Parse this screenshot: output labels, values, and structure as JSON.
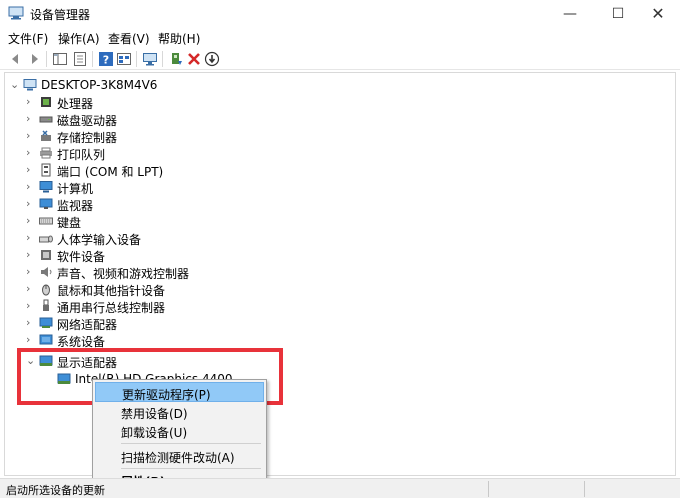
{
  "window": {
    "title": "设备管理器",
    "minimize_glyph": "—",
    "maximize_glyph": "☐",
    "close_glyph": "✕"
  },
  "menu": [
    "文件(F)",
    "操作(A)",
    "查看(V)",
    "帮助(H)"
  ],
  "toolbar": {
    "icons": [
      "back-icon",
      "forward-icon",
      "show-hide-tree-icon",
      "properties-icon",
      "help-icon",
      "view-icon",
      "monitor-scan-icon",
      "update-driver-icon",
      "uninstall-icon",
      "disable-icon"
    ],
    "uninstall_color": "#d42828"
  },
  "tree": {
    "root": "DESKTOP-3K8M4V6",
    "categories": [
      {
        "label": "处理器",
        "icon": "processor-icon"
      },
      {
        "label": "磁盘驱动器",
        "icon": "disk-drive-icon"
      },
      {
        "label": "存储控制器",
        "icon": "storage-controller-icon"
      },
      {
        "label": "打印队列",
        "icon": "printer-icon"
      },
      {
        "label": "端口 (COM 和 LPT)",
        "icon": "port-icon"
      },
      {
        "label": "计算机",
        "icon": "computer-icon"
      },
      {
        "label": "监视器",
        "icon": "monitor-icon"
      },
      {
        "label": "键盘",
        "icon": "keyboard-icon"
      },
      {
        "label": "人体学输入设备",
        "icon": "hid-icon"
      },
      {
        "label": "软件设备",
        "icon": "software-device-icon"
      },
      {
        "label": "声音、视频和游戏控制器",
        "icon": "sound-icon"
      },
      {
        "label": "鼠标和其他指针设备",
        "icon": "mouse-icon"
      },
      {
        "label": "通用串行总线控制器",
        "icon": "usb-icon"
      },
      {
        "label": "网络适配器",
        "icon": "network-adapter-icon"
      },
      {
        "label": "系统设备",
        "icon": "system-device-icon"
      },
      {
        "label": "显示适配器",
        "icon": "display-adapter-icon"
      }
    ],
    "expanded_child": "Intel(R) HD Graphics 4400"
  },
  "context_menu": {
    "items": [
      {
        "label": "更新驱动程序(P)",
        "selected": true
      },
      {
        "label": "禁用设备(D)",
        "selected": false
      },
      {
        "label": "卸载设备(U)",
        "selected": false
      },
      {
        "label": "扫描检测硬件改动(A)",
        "selected": false
      },
      {
        "label": "属性(R)",
        "selected": false
      }
    ],
    "highlight_color": "#91c9f7"
  },
  "annotation": {
    "color": "#e8323a"
  },
  "status": {
    "text": "启动所选设备的更新"
  }
}
